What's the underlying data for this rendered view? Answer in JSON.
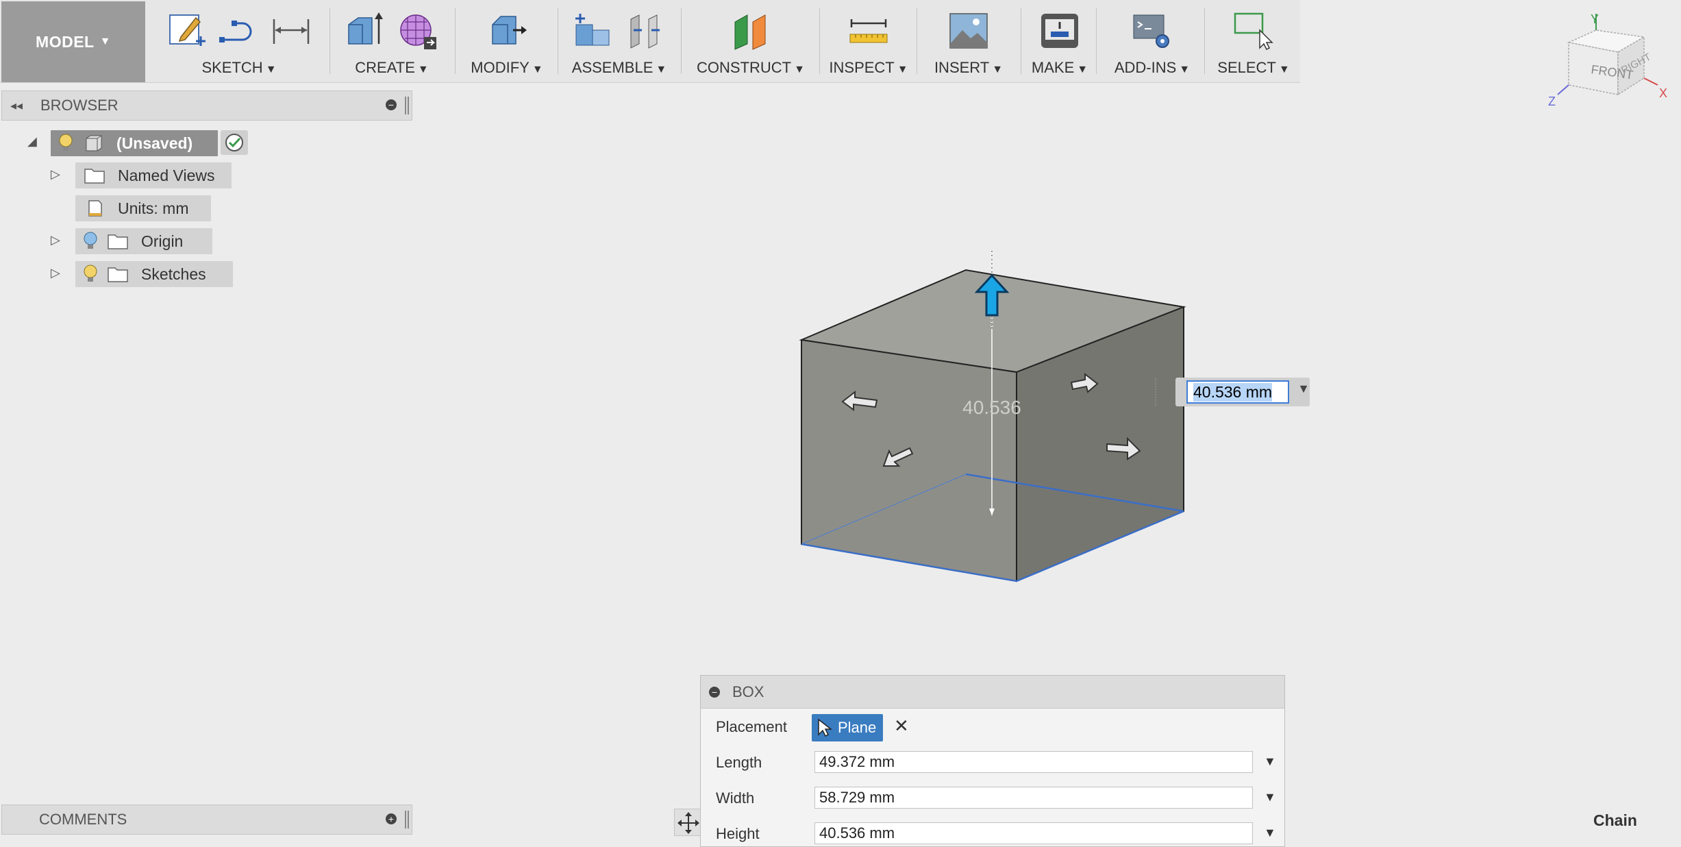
{
  "toolbar": {
    "workspace": "MODEL",
    "groups": [
      {
        "label": "SKETCH",
        "icons": [
          "create-sketch-icon",
          "line-spline-icon",
          "sketch-dimension-icon"
        ]
      },
      {
        "label": "CREATE",
        "icons": [
          "extrude-icon",
          "form-icon"
        ]
      },
      {
        "label": "MODIFY",
        "icons": [
          "press-pull-icon"
        ]
      },
      {
        "label": "ASSEMBLE",
        "icons": [
          "new-component-icon",
          "joint-icon"
        ]
      },
      {
        "label": "CONSTRUCT",
        "icons": [
          "offset-plane-icon"
        ]
      },
      {
        "label": "INSPECT",
        "icons": [
          "measure-icon"
        ]
      },
      {
        "label": "INSERT",
        "icons": [
          "insert-image-icon"
        ]
      },
      {
        "label": "MAKE",
        "icons": [
          "3d-print-icon"
        ]
      },
      {
        "label": "ADD-INS",
        "icons": [
          "scripts-icon"
        ]
      },
      {
        "label": "SELECT",
        "icons": [
          "select-icon"
        ]
      }
    ]
  },
  "browser": {
    "title": "BROWSER",
    "root": "(Unsaved)",
    "items": [
      {
        "label": "Named Views"
      },
      {
        "label": "Units: mm"
      },
      {
        "label": "Origin"
      },
      {
        "label": "Sketches"
      }
    ]
  },
  "viewport": {
    "height_readout": "40.536",
    "height_input": "40.536 mm"
  },
  "viewcube": {
    "front": "FRONT",
    "right": "RIGHT",
    "axis_x": "X",
    "axis_y": "Y",
    "axis_z": "Z"
  },
  "comments": {
    "title": "COMMENTS"
  },
  "box_dialog": {
    "title": "BOX",
    "placement_label": "Placement",
    "placement_value": "Plane",
    "length_label": "Length",
    "length_value": "49.372 mm",
    "width_label": "Width",
    "width_value": "58.729 mm",
    "height_label": "Height",
    "height_value": "40.536 mm"
  },
  "status": {
    "chain_label": "Chain"
  },
  "colors": {
    "accent": "#3a7cc0",
    "arrow_blue": "#1aa6e6",
    "cube_top": "#a0a19b",
    "cube_left": "#8e8e88",
    "cube_right": "#767670"
  }
}
